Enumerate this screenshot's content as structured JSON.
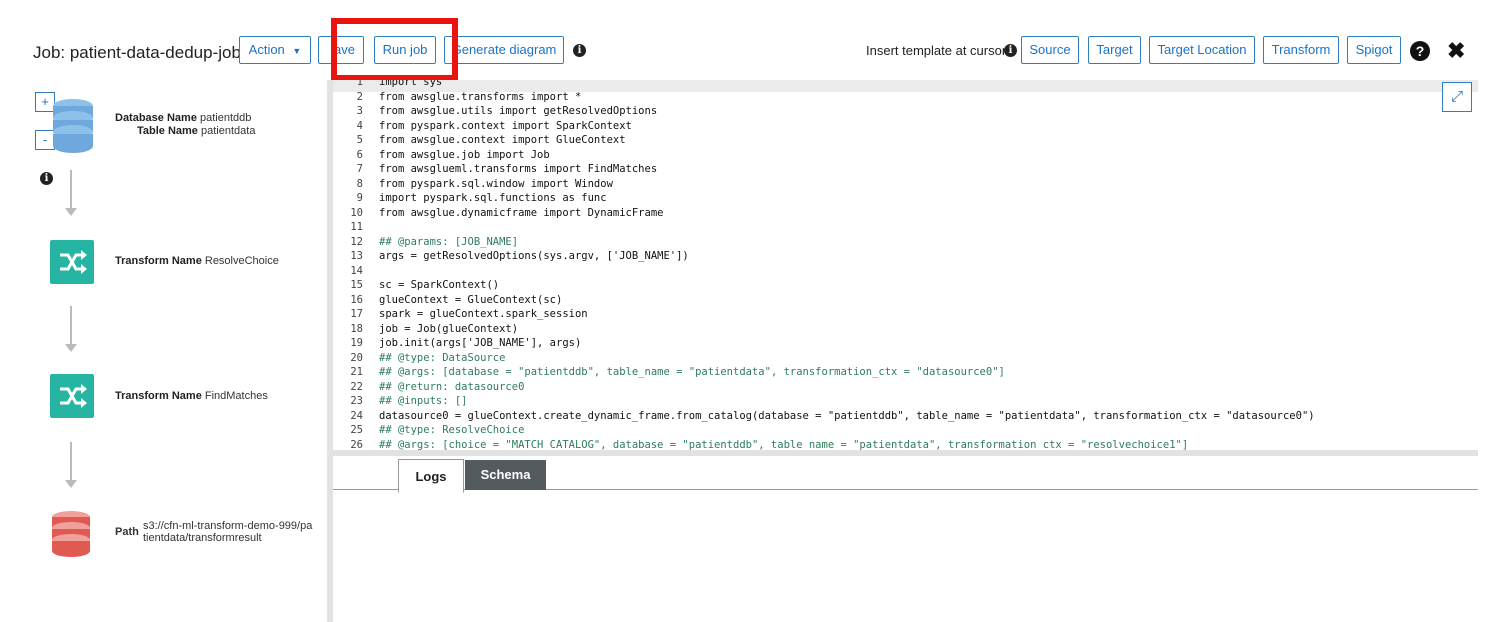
{
  "header": {
    "job_title": "Job: patient-data-dedup-job",
    "action_label": "Action",
    "save_label": "ave",
    "run_job_label": "Run job",
    "generate_diagram_label": "Generate diagram",
    "insert_template_label": "Insert template at cursor",
    "template_buttons": [
      "Source",
      "Target",
      "Target Location",
      "Transform",
      "Spigot"
    ],
    "help_icon": "?",
    "close_icon": "✖",
    "highlight_color": "#e8150f"
  },
  "diagram": {
    "zoom_in": "+",
    "zoom_out": "-",
    "source": {
      "database_key": "Database Name",
      "database_value": "patientddb",
      "table_key": "Table Name",
      "table_value": "patientdata"
    },
    "transform1": {
      "key": "Transform Name",
      "value": "ResolveChoice"
    },
    "transform2": {
      "key": "Transform Name",
      "value": "FindMatches"
    },
    "target": {
      "key": "Path",
      "value_line1": "s3://cfn-ml-transform-demo-999/pa",
      "value_line2": "tientdata/transformresult"
    },
    "colors": {
      "source": "#6fa8dc",
      "transform": "#26b5a3",
      "target": "#e05a52"
    }
  },
  "editor": {
    "lines": [
      {
        "n": "1",
        "t": "import sys"
      },
      {
        "n": "2",
        "t": "from awsglue.transforms import *"
      },
      {
        "n": "3",
        "t": "from awsglue.utils import getResolvedOptions"
      },
      {
        "n": "4",
        "t": "from pyspark.context import SparkContext"
      },
      {
        "n": "5",
        "t": "from awsglue.context import GlueContext"
      },
      {
        "n": "6",
        "t": "from awsglue.job import Job"
      },
      {
        "n": "7",
        "t": "from awsglueml.transforms import FindMatches"
      },
      {
        "n": "8",
        "t": "from pyspark.sql.window import Window"
      },
      {
        "n": "9",
        "t": "import pyspark.sql.functions as func"
      },
      {
        "n": "10",
        "t": "from awsglue.dynamicframe import DynamicFrame"
      },
      {
        "n": "11",
        "t": ""
      },
      {
        "n": "12",
        "t": "## @params: [JOB_NAME]"
      },
      {
        "n": "13",
        "t": "args = getResolvedOptions(sys.argv, ['JOB_NAME'])"
      },
      {
        "n": "14",
        "t": ""
      },
      {
        "n": "15",
        "t": "sc = SparkContext()"
      },
      {
        "n": "16",
        "t": "glueContext = GlueContext(sc)"
      },
      {
        "n": "17",
        "t": "spark = glueContext.spark_session"
      },
      {
        "n": "18",
        "t": "job = Job(glueContext)"
      },
      {
        "n": "19",
        "t": "job.init(args['JOB_NAME'], args)"
      },
      {
        "n": "20",
        "t": "## @type: DataSource"
      },
      {
        "n": "21",
        "t": "## @args: [database = \"patientddb\", table_name = \"patientdata\", transformation_ctx = \"datasource0\"]"
      },
      {
        "n": "22",
        "t": "## @return: datasource0"
      },
      {
        "n": "23",
        "t": "## @inputs: []"
      },
      {
        "n": "24",
        "t": "datasource0 = glueContext.create_dynamic_frame.from_catalog(database = \"patientddb\", table_name = \"patientdata\", transformation_ctx = \"datasource0\")"
      },
      {
        "n": "25",
        "t": "## @type: ResolveChoice"
      },
      {
        "n": "26",
        "t": "## @args: [choice = \"MATCH_CATALOG\", database = \"patientddb\", table_name = \"patientdata\", transformation_ctx = \"resolvechoice1\"]"
      }
    ],
    "expand_icon": "⤢"
  },
  "tabs": {
    "logs_label": "Logs",
    "schema_label": "Schema"
  }
}
